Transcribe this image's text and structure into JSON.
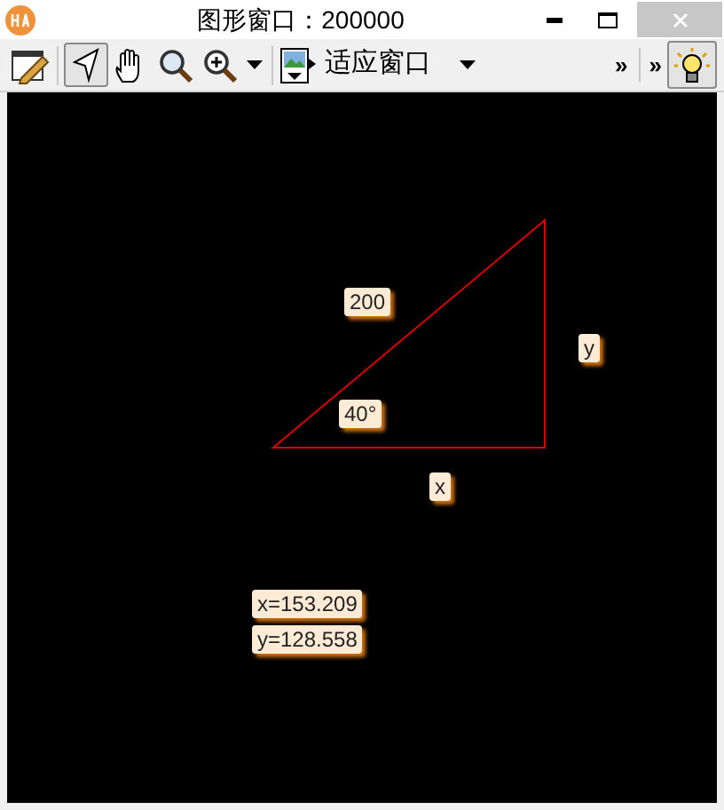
{
  "window": {
    "title": "图形窗口：200000"
  },
  "toolbar": {
    "tools": [
      {
        "kind": "edit",
        "selected": false
      },
      {
        "kind": "pointer",
        "selected": true
      },
      {
        "kind": "hand",
        "selected": false
      },
      {
        "kind": "search",
        "selected": false
      },
      {
        "kind": "zoom",
        "selected": false
      }
    ],
    "view_mode": "适应窗口",
    "overflow": [
      "»",
      "»"
    ],
    "hint_selected": true
  },
  "canvas": {
    "labels": [
      {
        "text": "200"
      },
      {
        "text": "40°"
      },
      {
        "text": "y"
      },
      {
        "text": "x"
      },
      {
        "text": "x=153.209"
      },
      {
        "text": "y=128.558"
      }
    ]
  }
}
